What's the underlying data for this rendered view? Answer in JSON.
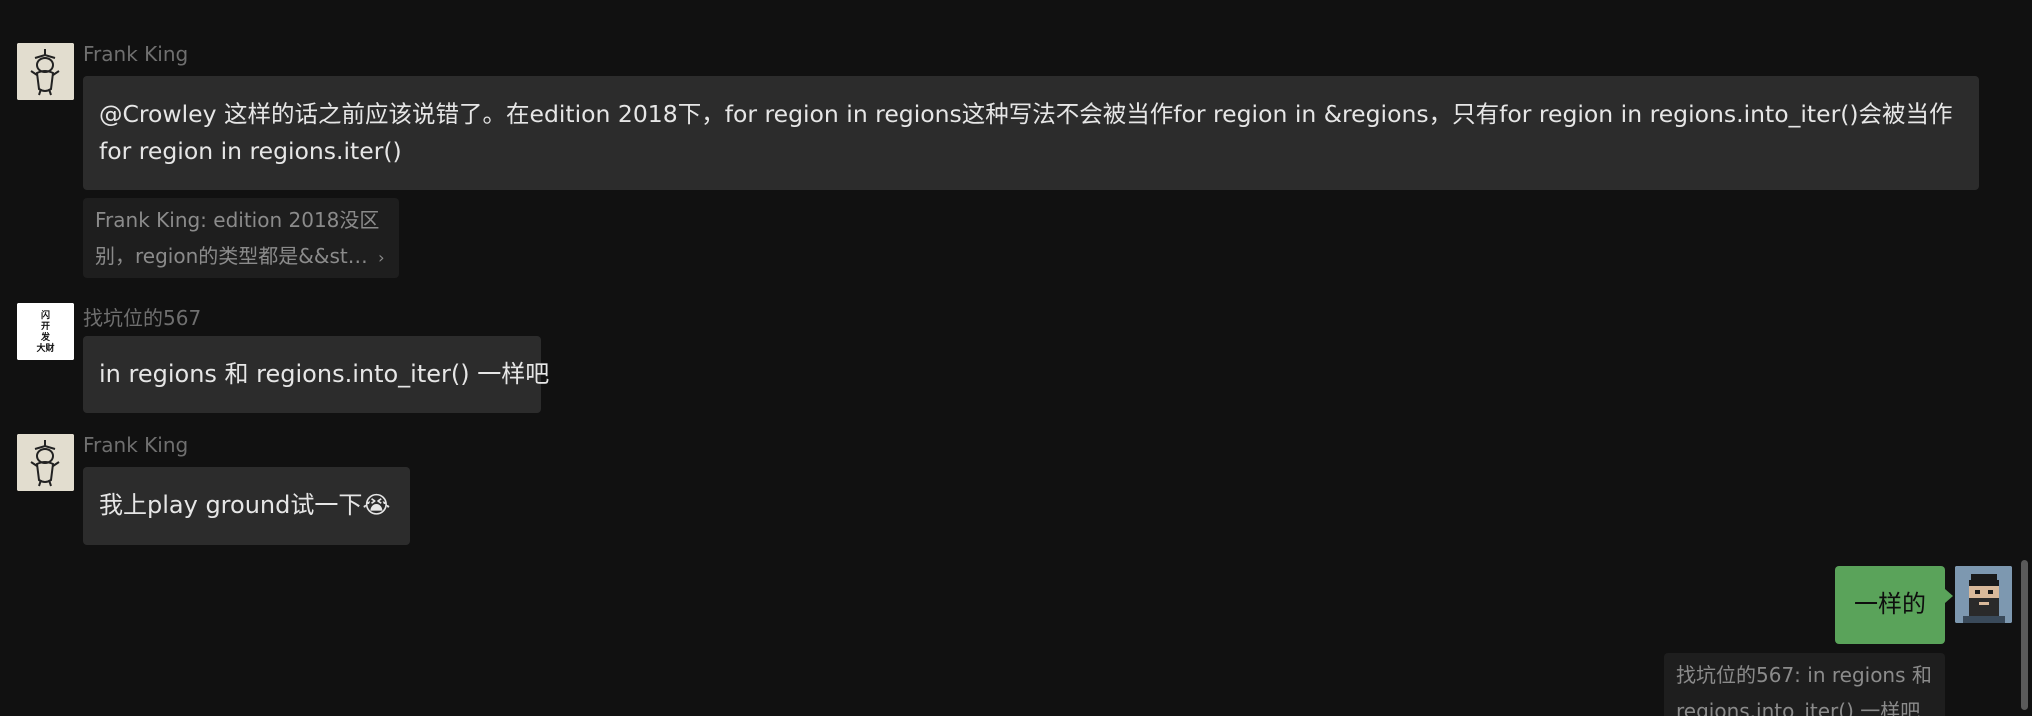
{
  "messages": [
    {
      "sender": "Frank King",
      "avatar_icon": "doodle-figure-avatar",
      "text": "@Crowley 这样的话之前应该说错了。在edition 2018下，for region in regions这种写法不会被当作for region in &regions，只有for region in regions.into_iter()会被当作for region in regions.iter()",
      "text_line1": "@Crowley 这样的话之前应该说错了。在edition 2018下，for region in regions这种写法不会被当作for region in &regions，只有for region in regions.into_iter()会被当作",
      "text_line2": "for region in regions.iter()"
    },
    {
      "quote_line1": "Frank King: edition 2018没区",
      "quote_line2": "别，region的类型都是&&st…",
      "quote_more": "›"
    },
    {
      "sender": "找坑位的567",
      "avatar_icon": "calligraphy-avatar",
      "avatar_text": "闪开发大财",
      "text": "in regions 和 regions.into_iter() 一样吧"
    },
    {
      "sender": "Frank King",
      "avatar_icon": "doodle-figure-avatar",
      "text": "我上play ground试一下",
      "emoji": "😭"
    },
    {
      "sender": "",
      "avatar_icon": "pixel-bearded-man-avatar",
      "text": "一样的",
      "mine": true
    },
    {
      "quote_line1": "找坑位的567: in regions 和",
      "quote_line2": "regions.into_iter() 一样吧"
    }
  ],
  "colors": {
    "background": "#111111",
    "bubble": "#2c2c2c",
    "bubble_mine": "#5aa35a",
    "sender": "#6f6f6f"
  }
}
